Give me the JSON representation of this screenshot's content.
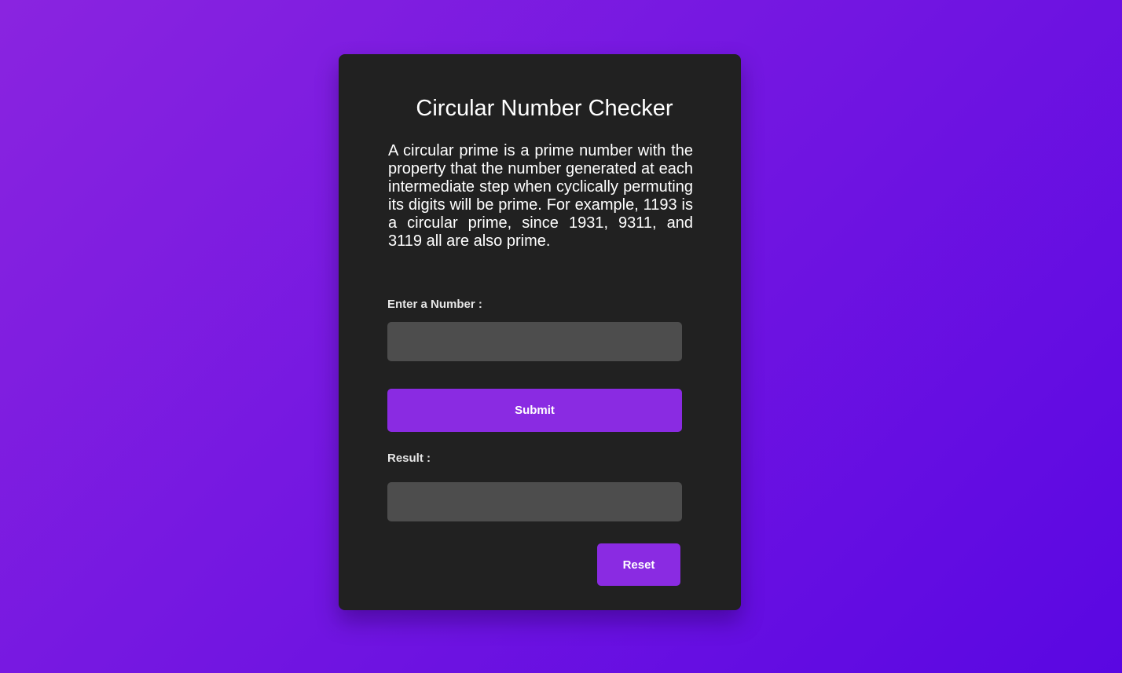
{
  "app": {
    "title": "Circular Number Checker",
    "description": "A circular prime is a prime number with the property that the number generated at each intermediate step when cyclically permuting its digits will be prime. For example, 1193 is a circular prime, since 1931, 9311, and 3119 all are also prime."
  },
  "form": {
    "number_label": "Enter a Number :",
    "number_value": "",
    "number_placeholder": "",
    "submit_label": "Submit",
    "result_label": "Result :",
    "result_value": "",
    "result_placeholder": "",
    "reset_label": "Reset"
  },
  "colors": {
    "background_gradient_start": "#8a24e0",
    "background_gradient_end": "#5a07e2",
    "card_background": "#212121",
    "input_background": "#4d4d4d",
    "button_accent": "#8a2be2",
    "text": "#ffffff"
  }
}
